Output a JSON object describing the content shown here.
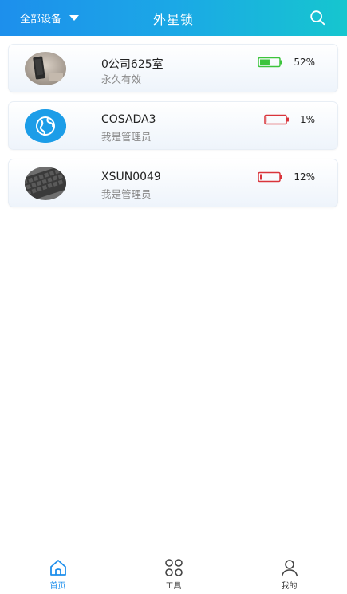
{
  "header": {
    "filter_label": "全部设备",
    "title": "外星锁",
    "search_icon": "search-icon"
  },
  "colors": {
    "header_start": "#1d8fec",
    "header_end": "#16c6cf",
    "battery_good": "#3cc43c",
    "battery_low": "#d9343b",
    "accent": "#1d8fec"
  },
  "devices": [
    {
      "name": "0公司625室",
      "status": "永久有效",
      "battery_percent_label": "52%",
      "battery_level": 0.52,
      "battery_state": "good",
      "avatar": "phone-photo"
    },
    {
      "name": "COSADA3",
      "status": "我是管理员",
      "battery_percent_label": "1%",
      "battery_level": 0.01,
      "battery_state": "low",
      "avatar": "globe-icon"
    },
    {
      "name": "XSUN0049",
      "status": "我是管理员",
      "battery_percent_label": "12%",
      "battery_level": 0.12,
      "battery_state": "low",
      "avatar": "keyboard-photo"
    }
  ],
  "tabs": [
    {
      "label": "首页",
      "icon": "home-icon",
      "active": true
    },
    {
      "label": "工具",
      "icon": "tools-grid-icon",
      "active": false
    },
    {
      "label": "我的",
      "icon": "user-icon",
      "active": false
    }
  ]
}
